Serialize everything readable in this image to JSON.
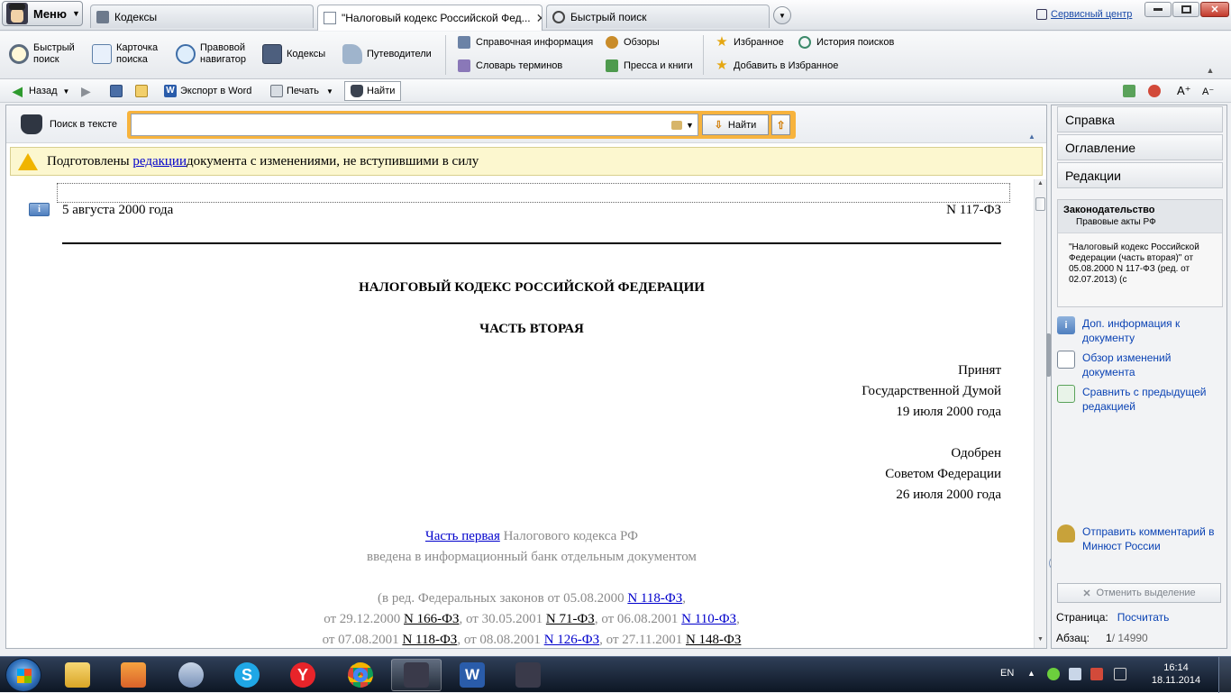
{
  "menu": {
    "label": "Меню"
  },
  "tabs": [
    {
      "label": "Кодексы",
      "active": false
    },
    {
      "label": "\"Налоговый кодекс Российской Фед...",
      "active": true
    },
    {
      "label": "Быстрый поиск",
      "active": false
    }
  ],
  "service_center": "Сервисный центр",
  "ribbon": {
    "quick_search": [
      "Быстрый",
      "поиск"
    ],
    "card_search": [
      "Карточка",
      "поиска"
    ],
    "legal_nav": [
      "Правовой",
      "навигатор"
    ],
    "codes": "Кодексы",
    "guides": "Путеводители",
    "reference": "Справочная информация",
    "glossary": "Словарь терминов",
    "reviews": "Обзоры",
    "press": "Пресса и книги",
    "favorites": "Избранное",
    "add_favorites": "Добавить в Избранное",
    "history": "История поисков"
  },
  "toolbar": {
    "back": "Назад",
    "export_word": "Экспорт в Word",
    "print": "Печать",
    "find": "Найти"
  },
  "search": {
    "label": "Поиск в тексте",
    "value": "",
    "find_button": "Найти"
  },
  "notice": {
    "prefix": "Подготовлены ",
    "link": "редакции",
    "suffix": " документа с изменениями, не вступившими в силу"
  },
  "document": {
    "date": "5 августа 2000 года",
    "number": "N 117-ФЗ",
    "title": "НАЛОГОВЫЙ КОДЕКС РОССИЙСКОЙ ФЕДЕРАЦИИ",
    "part": "ЧАСТЬ ВТОРАЯ",
    "adopted": [
      "Принят",
      "Государственной Думой",
      "19 июля 2000 года"
    ],
    "approved": [
      "Одобрен",
      "Советом Федерации",
      "26 июля 2000 года"
    ],
    "part_one_link": "Часть первая",
    "part_one_rest": " Налогового кодекса РФ",
    "part_one_line2": "введена в информационный банк отдельным документом",
    "amend_1_pre": "(в ред. Федеральных законов от 05.08.2000 ",
    "amend_1_link": "N 118-ФЗ",
    "amend_1_post": ",",
    "amend_2": [
      {
        "t": "от 29.12.2000 ",
        "k": "g"
      },
      {
        "t": "N 166-ФЗ",
        "k": "u"
      },
      {
        "t": ", от 30.05.2001 ",
        "k": "g"
      },
      {
        "t": "N 71-ФЗ",
        "k": "u"
      },
      {
        "t": ", от 06.08.2001 ",
        "k": "g"
      },
      {
        "t": "N 110-ФЗ",
        "k": "l"
      },
      {
        "t": ",",
        "k": "g"
      }
    ],
    "amend_3": [
      {
        "t": "от 07.08.2001 ",
        "k": "g"
      },
      {
        "t": "N 118-ФЗ",
        "k": "u"
      },
      {
        "t": ", от 08.08.2001 ",
        "k": "g"
      },
      {
        "t": "N 126-ФЗ",
        "k": "l"
      },
      {
        "t": ", от 27.11.2001 ",
        "k": "g"
      },
      {
        "t": "N 148-ФЗ",
        "k": "u"
      }
    ]
  },
  "right_panel": {
    "help": "Справка",
    "contents": "Оглавление",
    "editions": "Редакции",
    "info_title": "Законодательство",
    "info_subtitle": "Правовые акты РФ",
    "info_text": "\"Налоговый кодекс Российской Федерации (часть вторая)\" от 05.08.2000 N 117-ФЗ (ред. от 02.07.2013) (с",
    "link_more_info": "Доп. информация к документу",
    "link_changes": "Обзор изменений документа",
    "link_compare": "Сравнить с предыдущей редакцией",
    "link_comment": "Отправить комментарий в Минюст России",
    "cancel_selection": "Отменить выделение",
    "page_label": "Страница:",
    "page_value": "Посчитать",
    "para_label": "Абзац:",
    "para_current": "1",
    "para_total": " / 14990"
  },
  "taskbar": {
    "lang": "EN",
    "time": "16:14",
    "date": "18.11.2014"
  }
}
